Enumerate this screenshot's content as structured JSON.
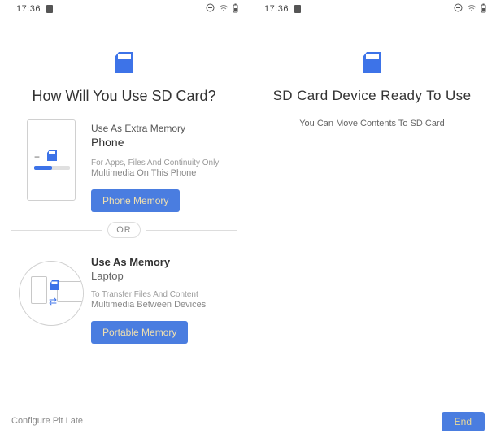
{
  "status": {
    "time": "17:36"
  },
  "left": {
    "title": "How Will You Use SD Card?",
    "opt1": {
      "heading": "Use As Extra Memory",
      "sub": "Phone",
      "desc1": "For Apps, Files And Continuity Only",
      "desc2": "Multimedia On This Phone",
      "button": "Phone Memory"
    },
    "divider": "OR",
    "opt2": {
      "heading": "Use As Memory",
      "sub": "Laptop",
      "desc1": "To Transfer Files And Content",
      "desc2": "Multimedia Between Devices",
      "button": "Portable Memory"
    },
    "configure_later": "Configure Pit Late"
  },
  "right": {
    "title": "SD Card Device Ready To Use",
    "msg": "You Can Move Contents To SD Card",
    "end": "End"
  }
}
